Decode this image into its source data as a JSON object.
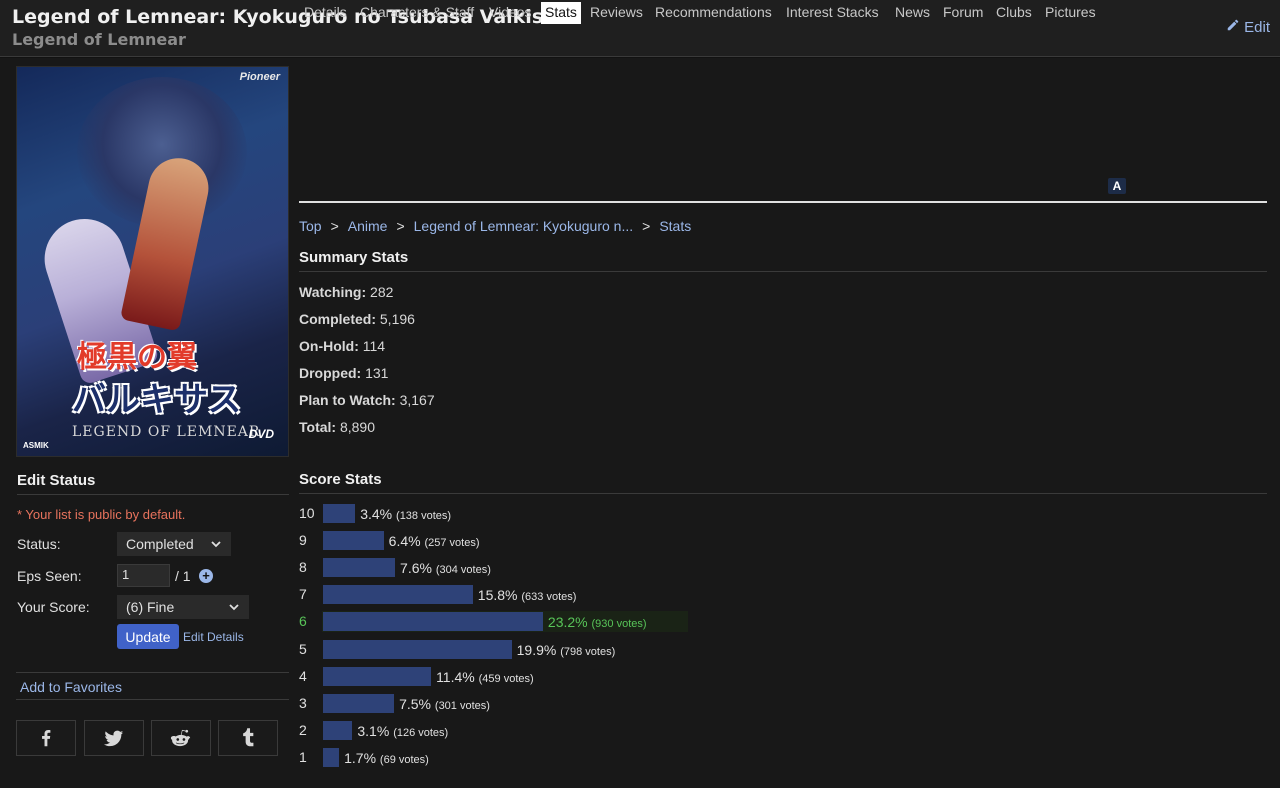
{
  "header": {
    "title": "Legend of Lemnear: Kyokuguro no Tsubasa Valkisas",
    "alt_title": "Legend of Lemnear",
    "edit_label": "Edit"
  },
  "poster": {
    "brand": "Pioneer",
    "jp_title_1": "極黒の翼",
    "jp_title_2": "バルキサス",
    "en_title": "LEGEND OF LEMNEAR",
    "dvd": "DVD",
    "publisher": "ASMIK"
  },
  "edit_status": {
    "heading": "Edit Status",
    "public_note": "* Your list is public by default.",
    "status_label": "Status:",
    "status_value": "Completed",
    "eps_label": "Eps Seen:",
    "eps_value": "1",
    "eps_total": "/ 1",
    "score_label": "Your Score:",
    "score_value": "(6) Fine",
    "update_label": "Update",
    "edit_details_label": "Edit Details"
  },
  "favorites": {
    "label": "Add to Favorites"
  },
  "share": [
    "facebook-icon",
    "twitter-icon",
    "reddit-icon",
    "tumblr-icon"
  ],
  "tabs": [
    {
      "label": "Details"
    },
    {
      "label": "Characters & Staff"
    },
    {
      "label": "Videos"
    },
    {
      "label": "Stats",
      "active": true
    },
    {
      "label": "Reviews"
    },
    {
      "label": "Recommendations"
    },
    {
      "label": "Interest Stacks"
    },
    {
      "label": "News"
    },
    {
      "label": "Forum"
    },
    {
      "label": "Clubs"
    },
    {
      "label": "Pictures"
    }
  ],
  "tab_icon_label": "A",
  "breadcrumb": [
    "Top",
    "Anime",
    "Legend of Lemnear: Kyokuguro n...",
    "Stats"
  ],
  "breadcrumb_sep": ">",
  "summary": {
    "heading": "Summary Stats",
    "items": [
      {
        "label": "Watching:",
        "value": "282"
      },
      {
        "label": "Completed:",
        "value": "5,196"
      },
      {
        "label": "On-Hold:",
        "value": "114"
      },
      {
        "label": "Dropped:",
        "value": "131"
      },
      {
        "label": "Plan to Watch:",
        "value": "3,167"
      },
      {
        "label": "Total:",
        "value": "8,890"
      }
    ]
  },
  "score_stats": {
    "heading": "Score Stats",
    "highlighted_score": "6",
    "rows": [
      {
        "score": "10",
        "pct": "3.4%",
        "votes": "(138 votes)",
        "value": 3.4
      },
      {
        "score": "9",
        "pct": "6.4%",
        "votes": "(257 votes)",
        "value": 6.4
      },
      {
        "score": "8",
        "pct": "7.6%",
        "votes": "(304 votes)",
        "value": 7.6
      },
      {
        "score": "7",
        "pct": "15.8%",
        "votes": "(633 votes)",
        "value": 15.8
      },
      {
        "score": "6",
        "pct": "23.2%",
        "votes": "(930 votes)",
        "value": 23.2
      },
      {
        "score": "5",
        "pct": "19.9%",
        "votes": "(798 votes)",
        "value": 19.9
      },
      {
        "score": "4",
        "pct": "11.4%",
        "votes": "(459 votes)",
        "value": 11.4
      },
      {
        "score": "3",
        "pct": "7.5%",
        "votes": "(301 votes)",
        "value": 7.5
      },
      {
        "score": "2",
        "pct": "3.1%",
        "votes": "(126 votes)",
        "value": 3.1
      },
      {
        "score": "1",
        "pct": "1.7%",
        "votes": "(69 votes)",
        "value": 1.7
      }
    ]
  },
  "colors": {
    "background": "#181818",
    "link": "#9bb7e8",
    "bar": "#2e4278",
    "highlight": "#58c458",
    "note": "#e8735d",
    "button": "#4062c8"
  }
}
